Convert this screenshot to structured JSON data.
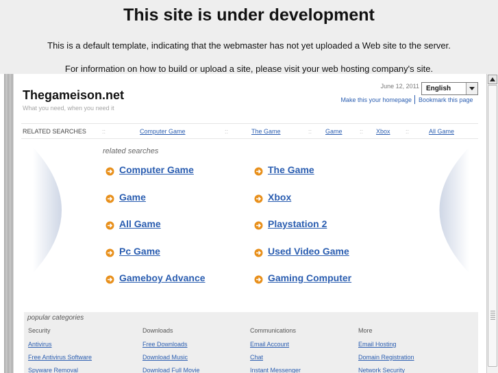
{
  "header": {
    "title": "This site is under development",
    "line1": "This is a default template, indicating that the webmaster has not yet uploaded a Web site to the server.",
    "line2": "For information on how to build or upload a site, please visit your web hosting company's site."
  },
  "site": {
    "name": "Thegameison.net",
    "tagline": "What you need, when you need it",
    "date": "June 12, 2011",
    "language": "English",
    "make_homepage": "Make this your homepage",
    "bookmark": "Bookmark this page"
  },
  "related_bar": {
    "label": "RELATED SEARCHES",
    "separator": "::",
    "links": [
      "Computer Game",
      "The Game",
      "Game",
      "Xbox",
      "All Game"
    ]
  },
  "related_searches": {
    "title": "related searches",
    "left": [
      "Computer Game",
      "Game",
      "All Game",
      "Pc Game",
      "Gameboy Advance"
    ],
    "right": [
      "The Game",
      "Xbox",
      "Playstation 2",
      "Used Video Game",
      "Gaming Computer"
    ]
  },
  "popular": {
    "title": "popular categories",
    "columns": [
      {
        "heading": "Security",
        "links": [
          "Antivirus",
          "Free Antivirus Software",
          "Spyware Removal"
        ]
      },
      {
        "heading": "Downloads",
        "links": [
          "Free Downloads",
          "Download Music",
          "Download Full Movie"
        ]
      },
      {
        "heading": "Communications",
        "links": [
          "Email Account",
          "Chat",
          "Instant Messenger"
        ]
      },
      {
        "heading": "More",
        "links": [
          "Email Hosting",
          "Domain Registration",
          "Network Security"
        ]
      }
    ]
  },
  "colors": {
    "link": "#2a5db0",
    "icon_orange": "#e8901c",
    "background": "#eeeeee"
  }
}
